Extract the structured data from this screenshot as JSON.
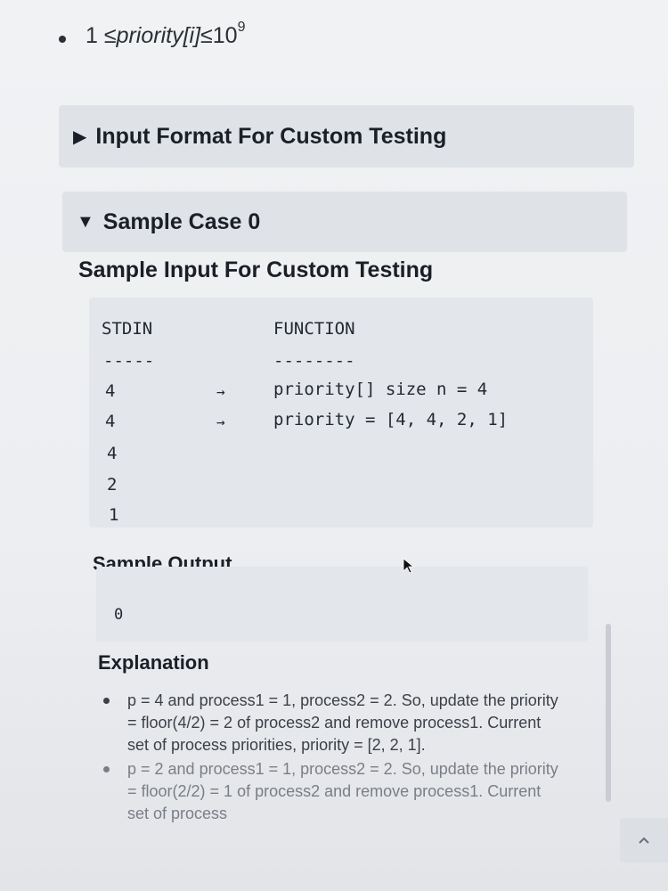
{
  "constraint": {
    "prefix": "1 ≤ ",
    "expr": "priority[i]",
    "suffix": " ≤10",
    "exponent": "9"
  },
  "accordions": [
    {
      "label": "Input Format For Custom Testing",
      "state": "collapsed",
      "arrow": "▶"
    },
    {
      "label": "Sample Case 0",
      "state": "expanded",
      "arrow": "▼"
    }
  ],
  "sample_input": {
    "title": "Sample Input For Custom Testing",
    "header_stdin": "STDIN",
    "header_function": "FUNCTION",
    "divider_stdin": "-----",
    "divider_function": "--------",
    "rows": [
      {
        "stdin": "4",
        "arrow": "→",
        "function": "priority[] size n = 4"
      },
      {
        "stdin": "4",
        "arrow": "→",
        "function": "priority = [4, 4, 2, 1]"
      },
      {
        "stdin": "4",
        "arrow": "",
        "function": ""
      },
      {
        "stdin": "2",
        "arrow": "",
        "function": ""
      },
      {
        "stdin": "1",
        "arrow": "",
        "function": ""
      }
    ]
  },
  "sample_output": {
    "title": "Sample Output",
    "value": "0"
  },
  "explanation": {
    "title": "Explanation",
    "items": [
      "p = 4 and process1 = 1, process2 = 2. So, update the priority = floor(4/2) = 2 of process2 and remove process1. Current set of process priorities, priority = [2, 2, 1].",
      "p = 2 and process1 = 1, process2 = 2. So, update the priority = floor(2/2) = 1 of process2 and remove process1. Current set of process"
    ]
  },
  "icons": {
    "scroll_up": "chevron-up-icon",
    "cursor": "mouse-cursor-icon"
  }
}
